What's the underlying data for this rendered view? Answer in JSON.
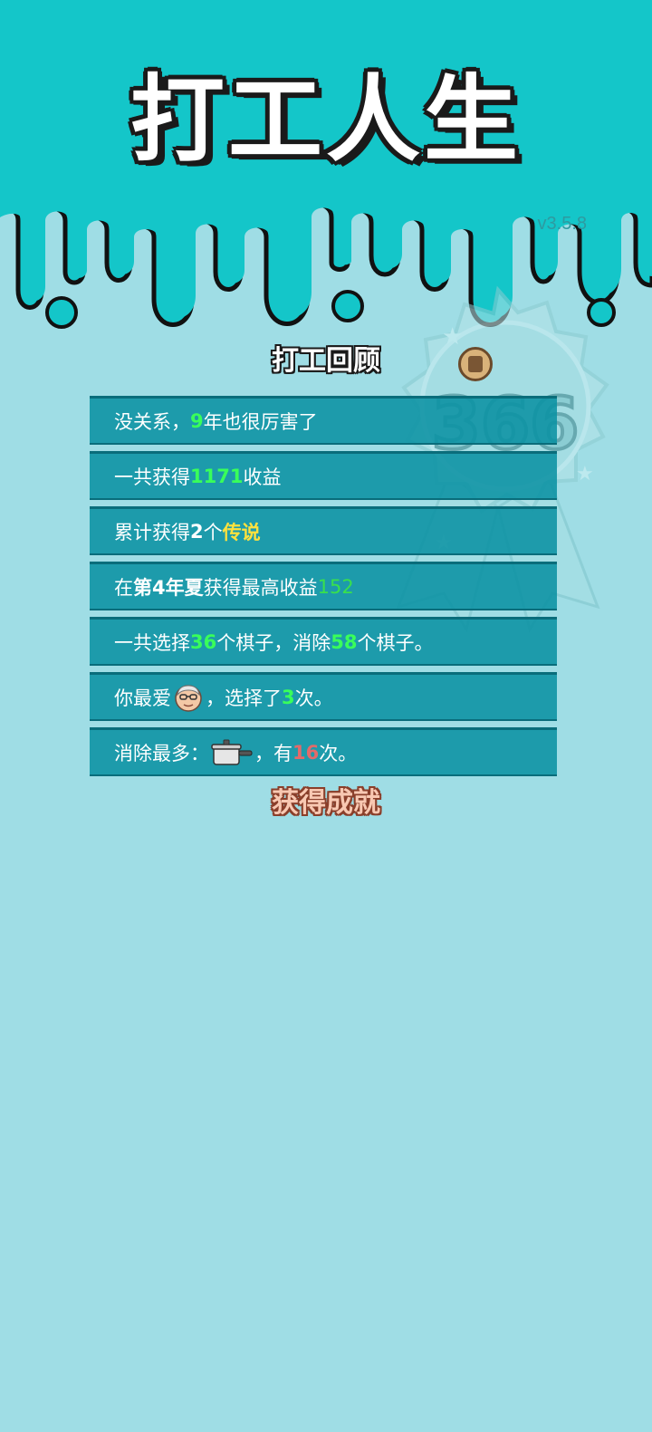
{
  "header": {
    "title": "打工人生",
    "version": "v3.5.8"
  },
  "badge": {
    "value": "366"
  },
  "review": {
    "title": "打工回顾",
    "rows": [
      {
        "parts": [
          "没关系，",
          "9",
          "年也很厉害了"
        ]
      },
      {
        "parts": [
          "一共获得",
          "1171",
          "收益"
        ]
      },
      {
        "parts": [
          "累计获得",
          "2",
          "个",
          "传说"
        ]
      },
      {
        "parts": [
          "在 ",
          "第4年夏",
          " 获得最高收益",
          "152"
        ]
      },
      {
        "parts": [
          "一共选择",
          "36",
          "个棋子，消除",
          "58",
          "个棋子。"
        ]
      },
      {
        "parts": [
          "你最爱",
          "，选择了",
          "3",
          "次。"
        ]
      },
      {
        "parts": [
          "消除最多：",
          "，有",
          "16",
          "次。"
        ]
      }
    ]
  },
  "achievements": {
    "title": "获得成就"
  },
  "icons": {
    "review_chip": "chip-coin-icon",
    "favorite_piece": "grandpa-face-icon",
    "most_removed_piece": "cooking-pot-icon"
  },
  "colors": {
    "header_bg": "#14c6c9",
    "page_bg": "#9fdde5",
    "row_bg": "#0b92a3",
    "highlight_green": "#39ff5a",
    "highlight_yellow": "#ffe23d",
    "highlight_red": "#e36a6a"
  }
}
